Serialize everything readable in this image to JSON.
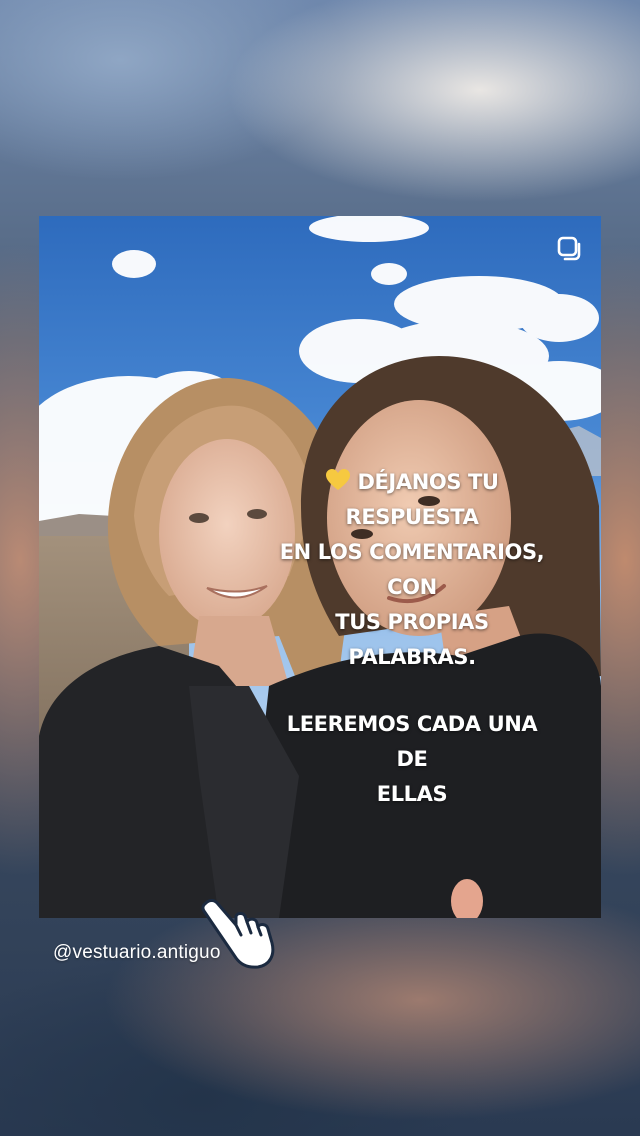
{
  "story": {
    "caption_line_1": "DÉJANOS TU RESPUESTA",
    "caption_line_2": "EN LOS COMENTARIOS, CON",
    "caption_line_3": "TUS PROPIAS PALABRAS.",
    "caption_line_4": "LEEREMOS CADA UNA DE",
    "caption_line_5": "ELLAS",
    "caption_emoji": "yellow-heart",
    "username": "@vestuario.antiguo"
  },
  "icons": {
    "multi_post": "repost-square-icon",
    "tap": "tap-hand-icon"
  },
  "colors": {
    "caption_text": "#ffffff",
    "heart": "#f6c940"
  }
}
